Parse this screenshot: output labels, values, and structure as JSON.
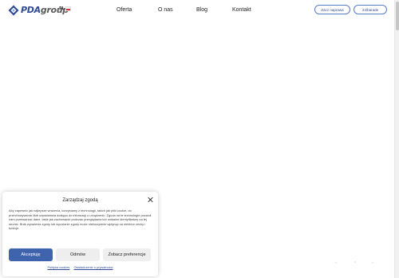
{
  "header": {
    "logo_part1": "PDA",
    "logo_part2": "group",
    "language": "PL",
    "nav": [
      "Oferta",
      "O nas",
      "Blog",
      "Kontakt"
    ],
    "demo_button": "Zacz naprawa",
    "hours_button": "24/barade"
  },
  "cookie": {
    "title": "Zarządzaj zgodą",
    "body": "Aby zapewnić jak najlepsze wrażenia, korzystamy z technologii, takich jak pliki cookie, do przechowywania i/lub uzyskiwania dostępu do informacji o urządzeniu. Zgoda na te technologie pozwoli nam przetwarzać dane, takie jak zachowanie podczas przeglądania lub unikalne identyfikatory na tej stronie. Brak wyrażenia zgody lub wycofanie zgody może niekorzystnie wpłynąć na niektóre cechy i funkcje.",
    "accept_label": "Akceptuję",
    "deny_label": "Odmów",
    "prefs_label": "Zobacz preferencje",
    "link_policy": "Polityka cookies",
    "link_privacy": "Oświadczenie o prywatności"
  },
  "colors": {
    "brand": "#2f4a93",
    "accent": "#3f63ad"
  }
}
